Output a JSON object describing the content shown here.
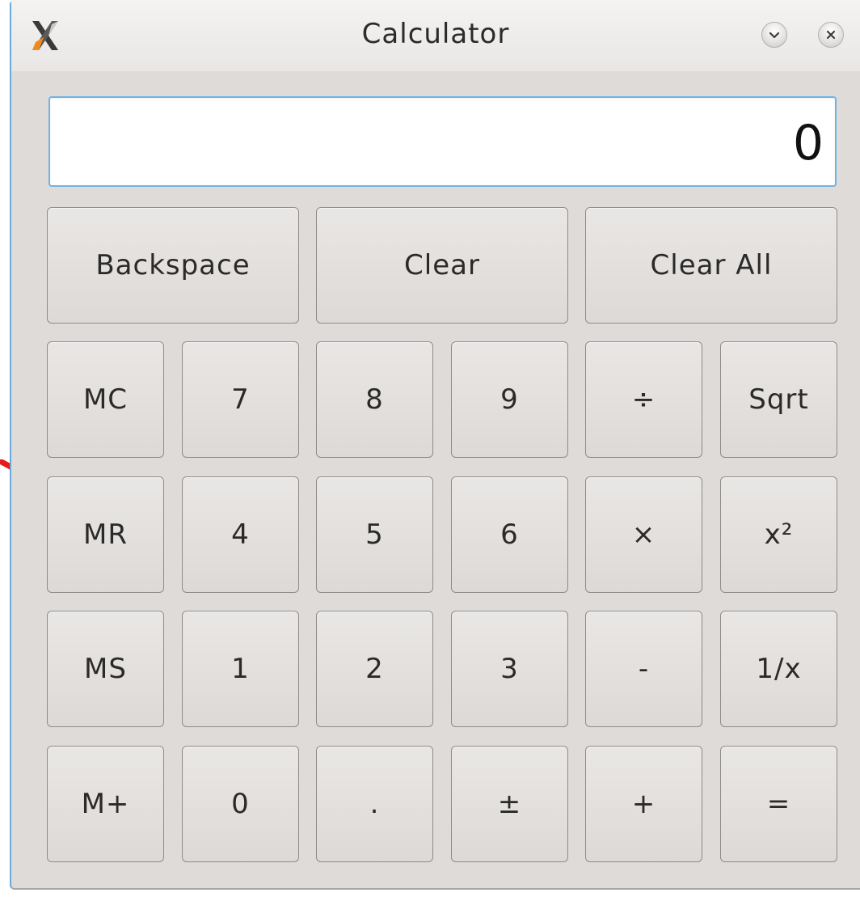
{
  "window": {
    "title": "Calculator"
  },
  "display": {
    "value": "0"
  },
  "row1": {
    "backspace": "Backspace",
    "clear": "Clear",
    "clear_all": "Clear All"
  },
  "row2": [
    "MC",
    "7",
    "8",
    "9",
    "÷",
    "Sqrt"
  ],
  "row3": [
    "MR",
    "4",
    "5",
    "6",
    "×",
    "x²"
  ],
  "row4": [
    "MS",
    "1",
    "2",
    "3",
    "-",
    "1/x"
  ],
  "row5": [
    "M+",
    "0",
    ".",
    "±",
    "+",
    "="
  ],
  "icons": {
    "app": "x-app-icon",
    "minimize": "chevron-down-icon",
    "close": "close-icon",
    "annotation": "red-arrow-icon"
  },
  "colors": {
    "window_bg": "#dedbd8",
    "display_border": "#6fb4e3",
    "annotation_arrow": "#e81b1b"
  }
}
